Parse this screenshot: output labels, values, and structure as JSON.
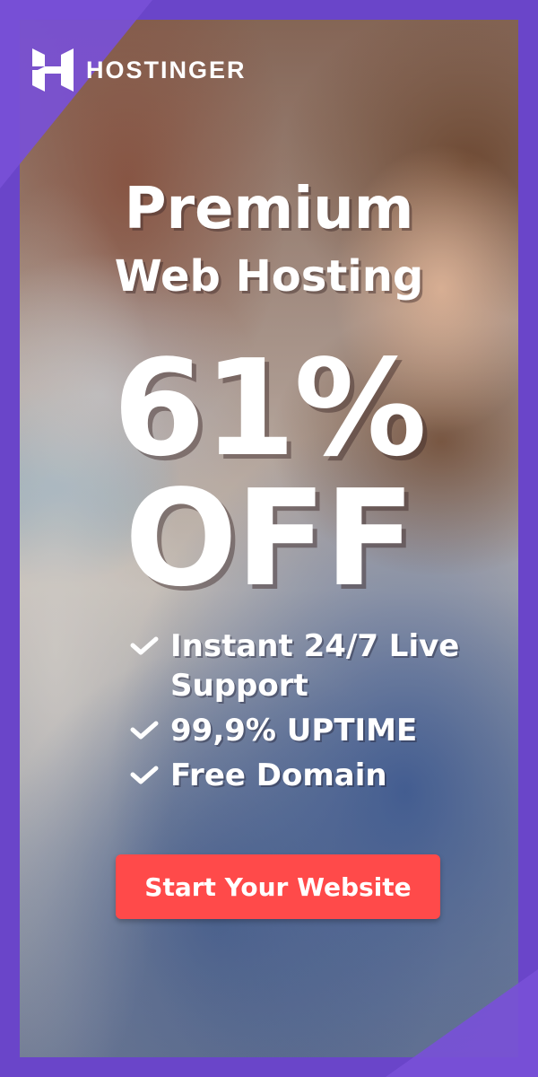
{
  "brand": {
    "name": "HOSTINGER",
    "logo_icon": "hostinger-h-logo",
    "accent_color": "#6a45c9",
    "corner_color": "#784fd7"
  },
  "headline": {
    "line1": "Premium",
    "line2": "Web Hosting"
  },
  "offer": {
    "discount": "61%",
    "off": "OFF"
  },
  "features": [
    {
      "icon": "check-icon",
      "text": "Instant 24/7 Live Support"
    },
    {
      "icon": "check-icon",
      "text": "99,9% UPTIME"
    },
    {
      "icon": "check-icon",
      "text": "Free Domain"
    }
  ],
  "cta": {
    "label": "Start Your Website",
    "color": "#ff4a4a"
  }
}
